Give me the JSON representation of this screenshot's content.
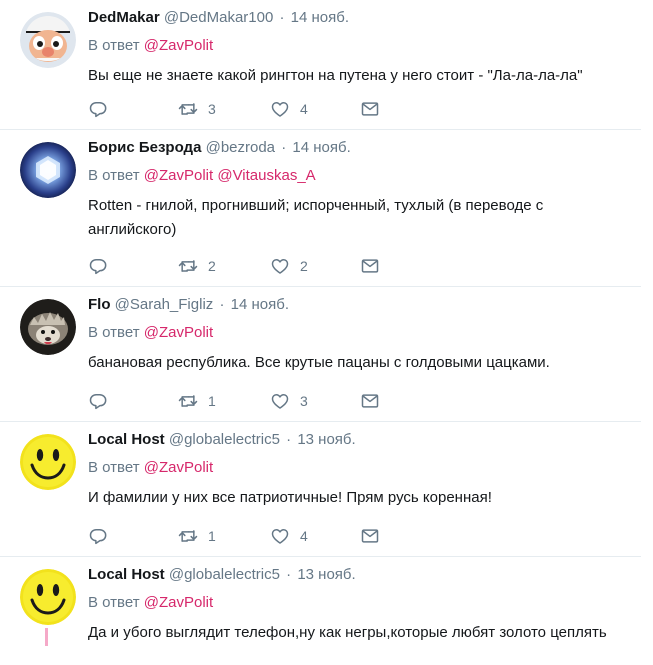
{
  "colors": {
    "mention": "#d6286b",
    "muted": "#657786",
    "text": "#14171a",
    "divider": "#e6ecf0"
  },
  "reply_prefix": "В ответ",
  "tweets": [
    {
      "name": "DedMakar",
      "handle": "@DedMakar100",
      "date": "14 нояб.",
      "mentions": [
        "@ZavPolit"
      ],
      "text": "Вы еще не знаете какой рингтон на путена у него стоит - \"Ла-ла-ла-ла\"",
      "replies": "",
      "retweets": "3",
      "likes": "4",
      "avatar_icon": "cartoon-face-avatar"
    },
    {
      "name": "Борис Безрода",
      "handle": "@bezroda",
      "date": "14 нояб.",
      "mentions": [
        "@ZavPolit",
        "@Vitauskas_A"
      ],
      "text": "Rotten - гнилой, прогнивший; испорченный, тухлый  (в переводе с английского)",
      "replies": "",
      "retweets": "2",
      "likes": "2",
      "avatar_icon": "crystal-orb-avatar"
    },
    {
      "name": "Flo",
      "handle": "@Sarah_Figliz",
      "date": "14 нояб.",
      "mentions": [
        "@ZavPolit"
      ],
      "text": "банановая республика. Все крутые пацаны с голдовыми цацками.",
      "replies": "",
      "retweets": "1",
      "likes": "3",
      "avatar_icon": "hedgehog-avatar"
    },
    {
      "name": "Local Host",
      "handle": "@globalelectric5",
      "date": "13 нояб.",
      "mentions": [
        "@ZavPolit"
      ],
      "text": "И фамилии у них все патриотичные! Прям русь коренная!",
      "replies": "",
      "retweets": "1",
      "likes": "4",
      "avatar_icon": "smiley-avatar"
    },
    {
      "name": "Local Host",
      "handle": "@globalelectric5",
      "date": "13 нояб.",
      "mentions": [
        "@ZavPolit"
      ],
      "text": "Да и убого выглядит телефон,ну как негры,которые любят золото цеплять",
      "avatar_icon": "smiley-avatar"
    }
  ]
}
